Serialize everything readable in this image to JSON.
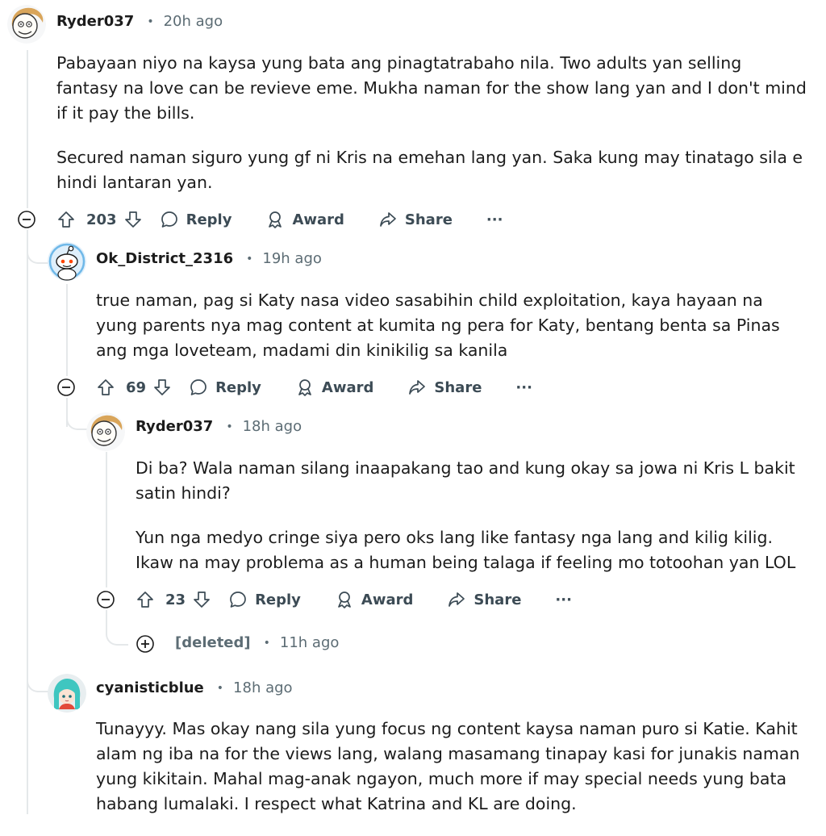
{
  "comments": [
    {
      "author": "Ryder037",
      "time": "20h ago",
      "paragraphs": [
        "Pabayaan niyo na kaysa yung bata ang pinagtatrabaho nila. Two adults yan selling fantasy na love can be revieve eme. Mukha naman for the show lang yan and I don't mind if it pay the bills.",
        "Secured naman siguro yung gf ni Kris na emehan lang yan. Saka kung may tinatago sila e hindi lantaran yan."
      ],
      "score": "203",
      "avatar_icon": "meme-face-avatar"
    },
    {
      "author": "Ok_District_2316",
      "time": "19h ago",
      "paragraphs": [
        "true naman, pag si Katy nasa video sasabihin child exploitation, kaya hayaan na yung parents nya mag content at kumita ng pera for Katy, bentang benta sa Pinas ang mga loveteam, madami din kinikilig sa kanila"
      ],
      "score": "69",
      "avatar_icon": "snoo-avatar"
    },
    {
      "author": "Ryder037",
      "time": "18h ago",
      "paragraphs": [
        "Di ba? Wala naman silang inaapakang tao and kung okay sa jowa ni Kris L bakit satin hindi?",
        "Yun nga medyo cringe siya pero oks lang like fantasy nga lang and kilig kilig. Ikaw na may problema as a human being talaga if feeling mo totoohan yan LOL"
      ],
      "score": "23",
      "avatar_icon": "meme-face-avatar"
    },
    {
      "author": "cyanisticblue",
      "time": "18h ago",
      "paragraphs": [
        "Tunayyy. Mas okay nang sila yung focus ng content kaysa naman puro si Katie. Kahit alam ng iba na for the views lang, walang masamang tinapay kasi for junakis naman yung kikitain. Mahal mag-anak ngayon, much more if may special needs yung bata habang lumalaki. I respect what Katrina and KL are doing."
      ],
      "avatar_icon": "anime-girl-avatar"
    }
  ],
  "deleted_comment": {
    "author": "[deleted]",
    "time": "11h ago"
  },
  "actions": {
    "reply": "Reply",
    "award": "Award",
    "share": "Share",
    "more": "···"
  },
  "colors": {
    "text": "#1c1c1c",
    "meta": "#5c6c74",
    "action": "#3c4b55",
    "thread": "#e5e8ea"
  }
}
